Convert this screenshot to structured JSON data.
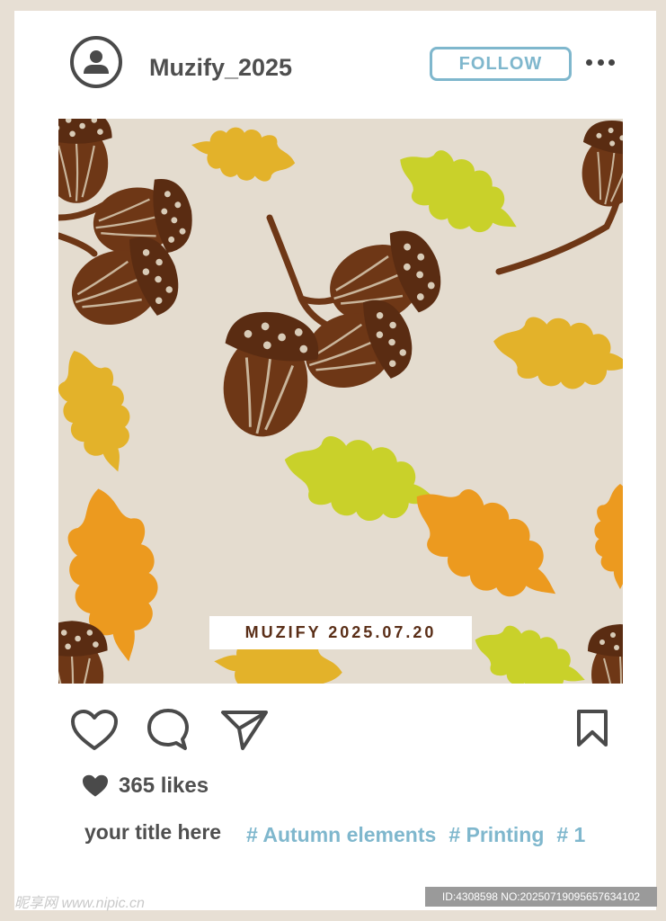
{
  "profile": {
    "username": "Muzify_2025",
    "follow_label": "FOLLOW",
    "avatar_icon": "user-avatar-icon",
    "more_icon": "more-dots-icon"
  },
  "post": {
    "image_stamp": "MUZIFY 2025.07.20",
    "image_theme": [
      "acorn",
      "oak-leaf"
    ],
    "colors": {
      "background": "#e4dccf",
      "acorn": "#6e3716",
      "leaf_yellow_green": "#c9d12a",
      "leaf_gold": "#e3b22a",
      "leaf_orange": "#ec9a1f"
    }
  },
  "actions": {
    "like_icon": "heart-outline-icon",
    "comment_icon": "comment-icon",
    "share_icon": "send-icon",
    "save_icon": "bookmark-icon"
  },
  "likes": {
    "icon": "heart-filled-icon",
    "text": "365 likes"
  },
  "caption": {
    "title": "your title here",
    "tags": [
      "# Autumn elements",
      "# Printing",
      "# 1"
    ]
  },
  "watermark": {
    "left": "昵享网 www.nipic.cn",
    "right": "ID:4308598 NO:20250719095657634102"
  },
  "accent_color": "#7fb7cd"
}
